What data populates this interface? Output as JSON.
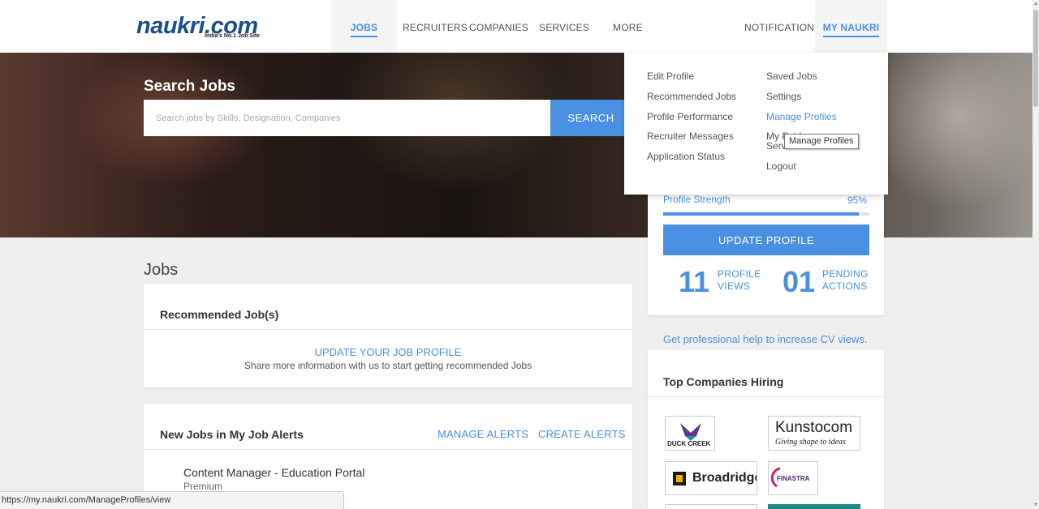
{
  "header": {
    "logo_text": "naukri.com",
    "logo_tagline": "India's No.1 Job Site",
    "nav": {
      "jobs": "JOBS",
      "recruiters": "RECRUITERS",
      "companies": "COMPANIES",
      "services": "SERVICES",
      "more": "MORE",
      "notifications": "NOTIFICATIONS",
      "my_naukri": "MY NAUKRI"
    }
  },
  "search": {
    "title": "Search Jobs",
    "placeholder": "Search jobs by Skills, Designation, Companies",
    "button": "SEARCH"
  },
  "my_naukri_menu": {
    "left": [
      "Edit Profile",
      "Recommended Jobs",
      "Profile Performance",
      "Recruiter Messages",
      "Application Status"
    ],
    "right": [
      "Saved Jobs",
      "Settings",
      "Manage Profiles",
      "My Paid Services",
      "Logout"
    ],
    "tooltip": "Manage Profiles"
  },
  "profile": {
    "strength_label": "Profile Strength",
    "strength_value": "95%",
    "strength_percent": 95,
    "update_button": "UPDATE PROFILE",
    "views_count": "11",
    "views_label_1": "PROFILE",
    "views_label_2": "VIEWS",
    "pending_count": "01",
    "pending_label_1": "PENDING",
    "pending_label_2": "ACTIONS"
  },
  "help_link": "Get professional help to increase CV views.",
  "top_companies": {
    "title": "Top Companies Hiring",
    "logos": [
      "DUCK CREEK",
      "Kunstocom",
      "Giving shape to ideas",
      "Broadridge",
      "FINASTRA"
    ]
  },
  "jobs": {
    "heading": "Jobs",
    "recommended_title": "Recommended Job(s)",
    "update_link": "UPDATE YOUR JOB PROFILE",
    "update_text": "Share more information with us to start getting recommended Jobs",
    "alerts_title": "New Jobs in My Job Alerts",
    "manage_alerts": "MANAGE ALERTS",
    "create_alerts": "CREATE ALERTS",
    "first_job_title": "Content Manager - Education Portal",
    "first_job_tag": "Premium"
  },
  "status_url": "https://my.naukri.com/ManageProfiles/view",
  "colors": {
    "accent": "#4a90e2",
    "brand": "#1a4f8b"
  }
}
